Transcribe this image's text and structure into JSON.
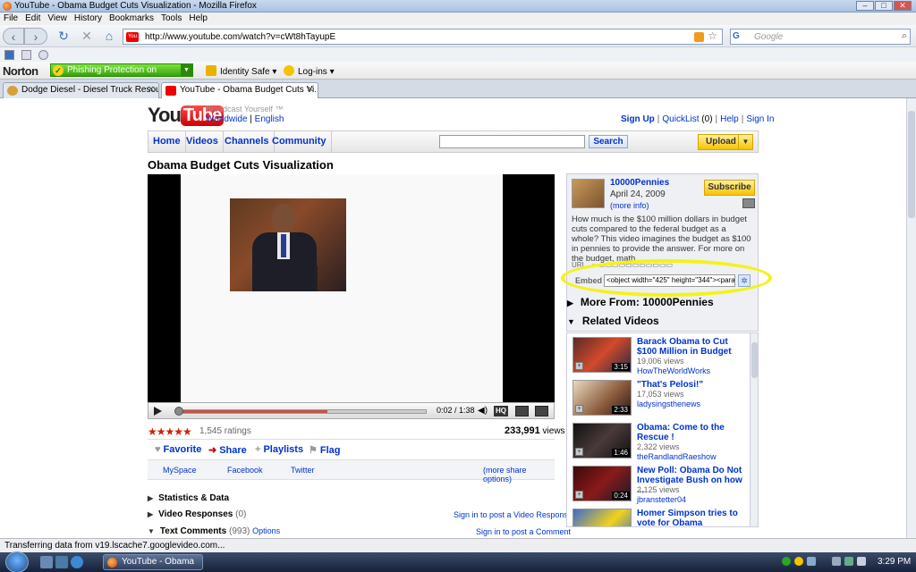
{
  "window": {
    "title": "YouTube - Obama Budget Cuts Visualization - Mozilla Firefox"
  },
  "menu": [
    "File",
    "Edit",
    "View",
    "History",
    "Bookmarks",
    "Tools",
    "Help"
  ],
  "nav": {
    "url": "http://www.youtube.com/watch?v=cWt8hTayupE",
    "search_placeholder": "Google",
    "search_engine": "G"
  },
  "norton": {
    "logo": "Norton",
    "phishing": "Phishing Protection on",
    "identity": "Identity Safe",
    "logins": "Log-ins"
  },
  "tabs": [
    {
      "label": "Dodge Diesel - Diesel Truck Resourc...",
      "active": false
    },
    {
      "label": "YouTube - Obama Budget Cuts Vi...",
      "active": true
    }
  ],
  "yt": {
    "logo_you": "You",
    "logo_tube": "Tube",
    "tagline": "Broadcast Yourself ™",
    "worldwide": "Worldwide",
    "english": "English",
    "toplinks": {
      "signup": "Sign Up",
      "quicklist": "QuickList",
      "quicklist_count": "(0)",
      "help": "Help",
      "signin": "Sign In"
    },
    "navtabs": [
      "Home",
      "Videos",
      "Channels",
      "Community"
    ],
    "search_btn": "Search",
    "upload_btn": "Upload",
    "video_title": "Obama Budget Cuts Visualization",
    "player": {
      "time": "0:02 / 1:38",
      "hq": "HQ",
      "progress_fraction": 0.6
    },
    "ratings": "1,545 ratings",
    "stars": "★★★★★",
    "views_count": "233,991",
    "views_word": "views",
    "actions": [
      "Favorite",
      "Share",
      "Playlists",
      "Flag"
    ],
    "share": [
      "MySpace",
      "Facebook",
      "Twitter"
    ],
    "more_share": "(more share options)",
    "sections": {
      "stats": "Statistics & Data",
      "responses": "Video Responses",
      "responses_count": "(0)",
      "responses_link": "Sign in to post a Video Response",
      "comments": "Text Comments",
      "comments_count": "(993)",
      "comments_options": "Options",
      "comments_link": "Sign in to post a Comment"
    },
    "channel": {
      "name": "10000Pennies",
      "date": "April 24, 2009",
      "more_info": "(more info)",
      "subscribe": "Subscribe",
      "description": "How much is the $100 million dollars in budget cuts compared to the federal budget as a whole? This video imagines the budget as $100 in pennies to provide the answer. For more on the budget, math..."
    },
    "embed": {
      "label": "Embed",
      "value": "<object width=\"425\" height=\"344\"><param"
    },
    "more_from": "More From: 10000Pennies",
    "related_title": "Related Videos",
    "related": [
      {
        "title": "Barack Obama to Cut $100 Million in Budget",
        "views": "19,006 views",
        "by": "HowTheWorldWorks",
        "dur": "3:15"
      },
      {
        "title": "\"That's Pelosi!\"",
        "views": "17,053 views",
        "by": "ladysingsthenews",
        "dur": "2:33"
      },
      {
        "title": "Obama: Come to the Rescue !",
        "views": "2,322 views",
        "by": "theRandlandRaeshow",
        "dur": "1:46"
      },
      {
        "title": "New Poll: Obama Do Not Investigate Bush on how ...",
        "views": "2,125 views",
        "by": "jbranstetter04",
        "dur": "0:24"
      },
      {
        "title": "Homer Simpson tries to vote for Obama",
        "views": "",
        "by": "",
        "dur": ""
      }
    ]
  },
  "status": "Transferring data from v19.lscache7.googlevideo.com...",
  "taskbar": {
    "window_btn": "YouTube - Obama ...",
    "clock": "3:29 PM"
  },
  "colors": {
    "youtube_red": "#cc0000",
    "link_blue": "#0033cc",
    "highlight_yellow": "#f4f21a",
    "norton_green": "#33a30a"
  }
}
